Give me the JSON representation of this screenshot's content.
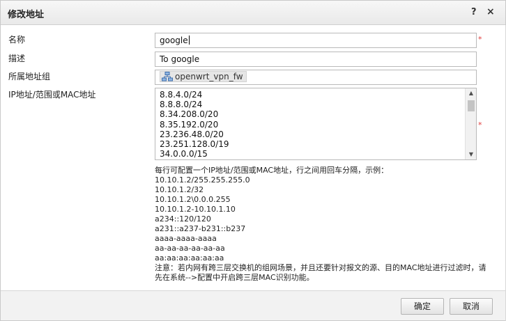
{
  "dialog": {
    "title": "修改地址",
    "help_icon": "?",
    "close_icon": "×"
  },
  "form": {
    "name": {
      "label": "名称",
      "value": "google",
      "required_mark": "*"
    },
    "description": {
      "label": "描述",
      "value": "To google"
    },
    "group": {
      "label": "所属地址组",
      "chip": "openwrt_vpn_fw",
      "chip_icon": "network-group-icon"
    },
    "addresses": {
      "label": "IP地址/范围或MAC地址",
      "required_mark": "*",
      "items": [
        "8.8.4.0/24",
        "8.8.8.0/24",
        "8.34.208.0/20",
        "8.35.192.0/20",
        "23.236.48.0/20",
        "23.251.128.0/19",
        "34.0.0.0/15"
      ]
    }
  },
  "help": {
    "lines": [
      "每行可配置一个IP地址/范围或MAC地址，行之间用回车分隔，示例：",
      "10.10.1.2/255.255.255.0",
      "10.10.1.2/32",
      "10.10.1.2\\0.0.0.255",
      "10.10.1.2-10.10.1.10",
      "a234::120/120",
      "a231::a237-b231::b237",
      "aaaa-aaaa-aaaa",
      "aa-aa-aa-aa-aa-aa",
      "aa:aa:aa:aa:aa:aa"
    ],
    "note": "注意：若内网有跨三层交换机的组网场景，并且还要针对报文的源、目的MAC地址进行过滤时，请先在系统-->配置中开启跨三层MAC识别功能。"
  },
  "footer": {
    "ok_label": "确定",
    "cancel_label": "取消"
  }
}
